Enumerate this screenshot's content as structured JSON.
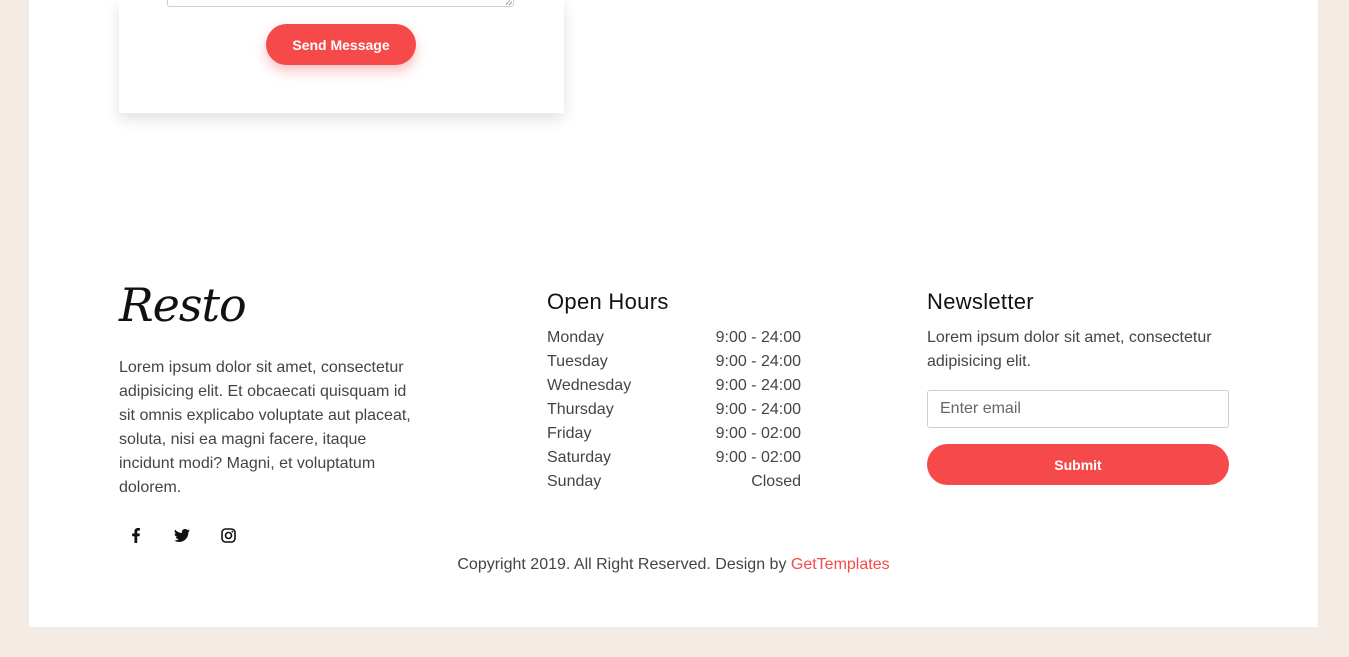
{
  "contact": {
    "send_label": "Send Message"
  },
  "brand": {
    "name": "Resto",
    "about": "Lorem ipsum dolor sit amet, consectetur adipisicing elit. Et obcaecati quisquam id sit omnis explicabo voluptate aut placeat, soluta, nisi ea magni facere, itaque incidunt modi? Magni, et voluptatum dolorem."
  },
  "social": [
    {
      "icon": "facebook-icon"
    },
    {
      "icon": "twitter-icon"
    },
    {
      "icon": "instagram-icon"
    }
  ],
  "hours": {
    "title": "Open Hours",
    "rows": [
      {
        "day": "Monday",
        "time": "9:00 - 24:00"
      },
      {
        "day": "Tuesday",
        "time": "9:00 - 24:00"
      },
      {
        "day": "Wednesday",
        "time": "9:00 - 24:00"
      },
      {
        "day": "Thursday",
        "time": "9:00 - 24:00"
      },
      {
        "day": "Friday",
        "time": "9:00 - 02:00"
      },
      {
        "day": "Saturday",
        "time": "9:00 - 02:00"
      },
      {
        "day": "Sunday",
        "time": "Closed"
      }
    ]
  },
  "newsletter": {
    "title": "Newsletter",
    "text": "Lorem ipsum dolor sit amet, consectetur adipisicing elit.",
    "email_placeholder": "Enter email",
    "submit_label": "Submit"
  },
  "footer": {
    "copyright_text": "Copyright 2019. All Right Reserved. Design by ",
    "credit_link": "GetTemplates"
  },
  "colors": {
    "accent": "#f64a4a",
    "page_bg": "#f3ebe4",
    "card_bg": "#ffffff"
  }
}
